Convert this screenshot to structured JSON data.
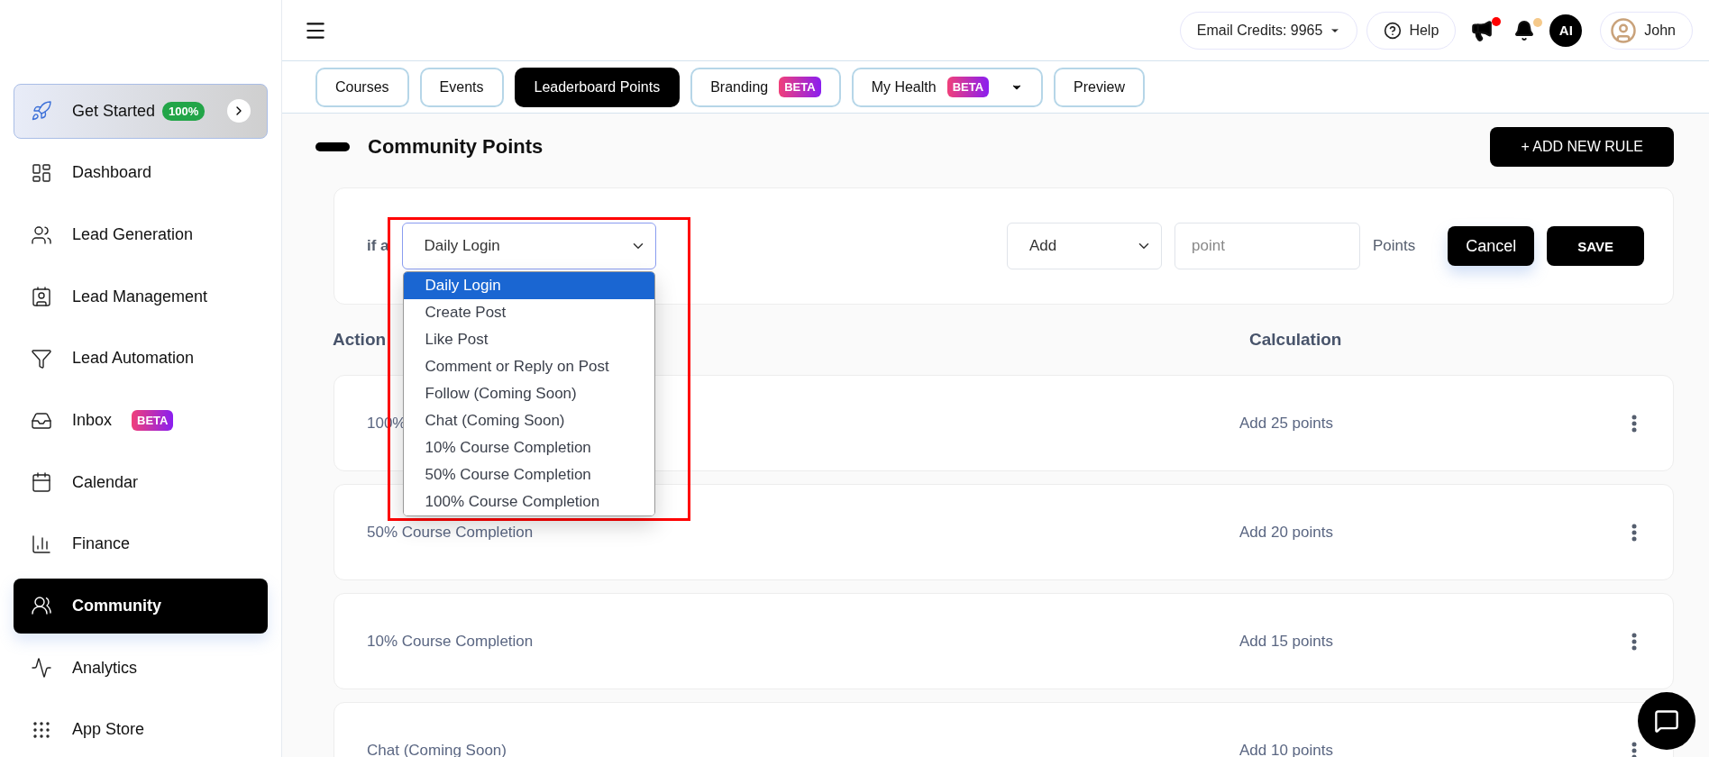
{
  "sidebar": {
    "items": [
      {
        "label": "Get Started",
        "kind": "featured",
        "badge": "100%",
        "selected": false
      },
      {
        "label": "Dashboard",
        "kind": "dashboard",
        "selected": false
      },
      {
        "label": "Lead Generation",
        "kind": "leads",
        "selected": false
      },
      {
        "label": "Lead Management",
        "kind": "management",
        "selected": false
      },
      {
        "label": "Lead Automation",
        "kind": "automation",
        "selected": false
      },
      {
        "label": "Inbox",
        "kind": "inbox",
        "badge": "BETA",
        "selected": false
      },
      {
        "label": "Calendar",
        "kind": "calendar",
        "selected": false
      },
      {
        "label": "Finance",
        "kind": "finance",
        "selected": false
      },
      {
        "label": "Community",
        "kind": "community",
        "selected": true
      },
      {
        "label": "Analytics",
        "kind": "analytics",
        "selected": false
      },
      {
        "label": "App Store",
        "kind": "apps",
        "selected": false
      }
    ]
  },
  "header": {
    "credits": "Email Credits: 9965",
    "help": "Help",
    "assistant": "AI",
    "user": "John"
  },
  "tabs": [
    {
      "label": "Courses",
      "selected": false,
      "dropdown": false
    },
    {
      "label": "Events",
      "selected": false,
      "dropdown": false
    },
    {
      "label": "Leaderboard Points",
      "selected": true,
      "dropdown": false
    },
    {
      "label": "Branding",
      "badge": "BETA",
      "selected": false,
      "dropdown": false
    },
    {
      "label": "My Health",
      "badge": "BETA",
      "selected": false,
      "dropdown": true
    },
    {
      "label": "Preview",
      "selected": false,
      "dropdown": false
    }
  ],
  "section": {
    "title": "Community Points",
    "add_button": "+ ADD NEW RULE"
  },
  "rule_form": {
    "condition_label": "if a",
    "trigger": {
      "value": "Daily Login",
      "open": true,
      "options": [
        {
          "label": "Daily Login",
          "selected": true
        },
        {
          "label": "Create Post",
          "selected": false
        },
        {
          "label": "Like Post",
          "selected": false
        },
        {
          "label": "Comment or Reply on Post",
          "selected": false
        },
        {
          "label": "Follow (Coming Soon)",
          "selected": false
        },
        {
          "label": "Chat (Coming Soon)",
          "selected": false
        },
        {
          "label": "10% Course Completion",
          "selected": false
        },
        {
          "label": "50% Course Completion",
          "selected": false
        },
        {
          "label": "100% Course Completion",
          "selected": false
        }
      ]
    },
    "operation": "Add",
    "points_placeholder": "point",
    "points_unit": "Points",
    "cancel": "Cancel",
    "save": "SAVE"
  },
  "table": {
    "columns": [
      "Action",
      "Calculation"
    ],
    "rows": [
      {
        "action": "100%",
        "calculation": "Add 25 points"
      },
      {
        "action": "50% Course Completion",
        "calculation": "Add 20 points"
      },
      {
        "action": "10% Course Completion",
        "calculation": "Add 15 points"
      },
      {
        "action": "Chat (Coming Soon)",
        "calculation": "Add 10 points"
      }
    ]
  }
}
